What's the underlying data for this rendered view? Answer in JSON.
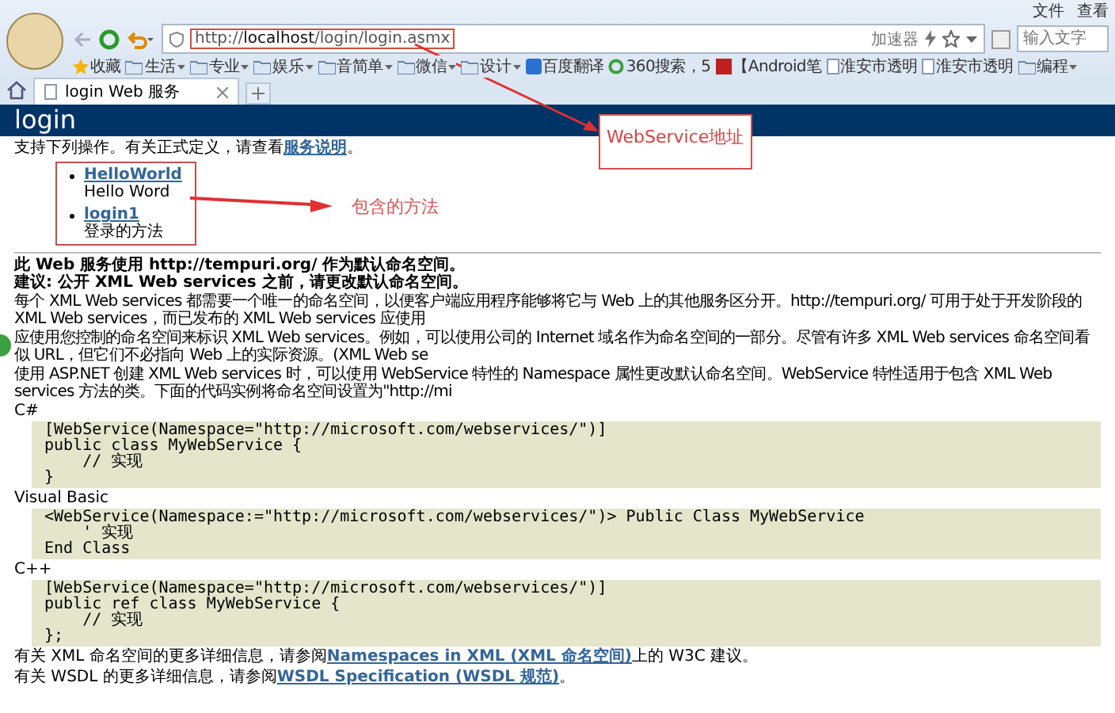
{
  "menu": [
    "文件",
    "查看"
  ],
  "address": {
    "url_prefix": "http://",
    "url_host": "localhost",
    "url_path": "/login/login.asmx",
    "accelerator": "加速器",
    "search_placeholder": "输入文字"
  },
  "bookmarks": [
    {
      "label": "收藏",
      "kind": "star"
    },
    {
      "label": "生活",
      "kind": "folder"
    },
    {
      "label": "专业",
      "kind": "folder"
    },
    {
      "label": "娱乐",
      "kind": "folder"
    },
    {
      "label": "音简单",
      "kind": "folder"
    },
    {
      "label": "微信",
      "kind": "folder"
    },
    {
      "label": "设计",
      "kind": "folder"
    },
    {
      "label": "百度翻译",
      "kind": "app"
    },
    {
      "label": "360搜索，5",
      "kind": "ring"
    },
    {
      "label": "【Android笔",
      "kind": "red"
    },
    {
      "label": "淮安市透明",
      "kind": "page"
    },
    {
      "label": "淮安市透明",
      "kind": "page"
    },
    {
      "label": "编程",
      "kind": "folder"
    }
  ],
  "tabs": [
    {
      "label": "login Web 服务",
      "selected": true
    }
  ],
  "page_title": "login",
  "intro": {
    "text": "支持下列操作。有关正式定义，请查看",
    "link": "服务说明",
    "end": "。"
  },
  "operations": [
    {
      "name": "HelloWorld",
      "description": "Hello Word"
    },
    {
      "name": "login1",
      "description": "登录的方法"
    }
  ],
  "notes": [
    "此 Web 服务使用 http://tempuri.org/ 作为默认命名空间。",
    "建议: 公开 XML Web services 之前，请更改默认命名空间。"
  ],
  "paragraphs": [
    "每个 XML Web services 都需要一个唯一的命名空间，以便客户端应用程序能够将它与 Web 上的其他服务区分开。http://tempuri.org/ 可用于处于开发阶段的 XML Web services，而已发布的 XML Web services 应使用",
    "应使用您控制的命名空间来标识 XML Web services。例如，可以使用公司的 Internet 域名作为命名空间的一部分。尽管有许多 XML Web services 命名空间看似 URL，但它们不必指向 Web 上的实际资源。(XML Web se",
    "使用 ASP.NET 创建 XML Web services 时，可以使用 WebService 特性的 Namespace 属性更改默认命名空间。WebService 特性适用于包含 XML Web services 方法的类。下面的代码实例将命名空间设置为\"http://mi"
  ],
  "samples": [
    {
      "language": "C#",
      "code": [
        "[WebService(Namespace=\"http://microsoft.com/webservices/\")]",
        "public class MyWebService {",
        "    // 实现",
        "}"
      ]
    },
    {
      "language": "Visual Basic",
      "code": [
        "<WebService(Namespace:=\"http://microsoft.com/webservices/\")> Public Class MyWebService",
        "    ' 实现",
        "End Class"
      ]
    },
    {
      "language": "C++",
      "code": [
        "[WebService(Namespace=\"http://microsoft.com/webservices/\")]",
        "public ref class MyWebService {",
        "    // 实现",
        "};"
      ]
    }
  ],
  "footer": [
    {
      "text": "有关 XML 命名空间的更多详细信息，请参阅",
      "link": "Namespaces in XML (XML 命名空间)",
      "end": "上的 W3C 建议。"
    },
    {
      "text": "有关 WSDL 的更多详细信息，请参阅",
      "link": "WSDL Specification (WSDL 规范)",
      "end": "。"
    }
  ],
  "annotations": [
    {
      "label": "WebService地址"
    },
    {
      "label": "包含的方法"
    }
  ]
}
